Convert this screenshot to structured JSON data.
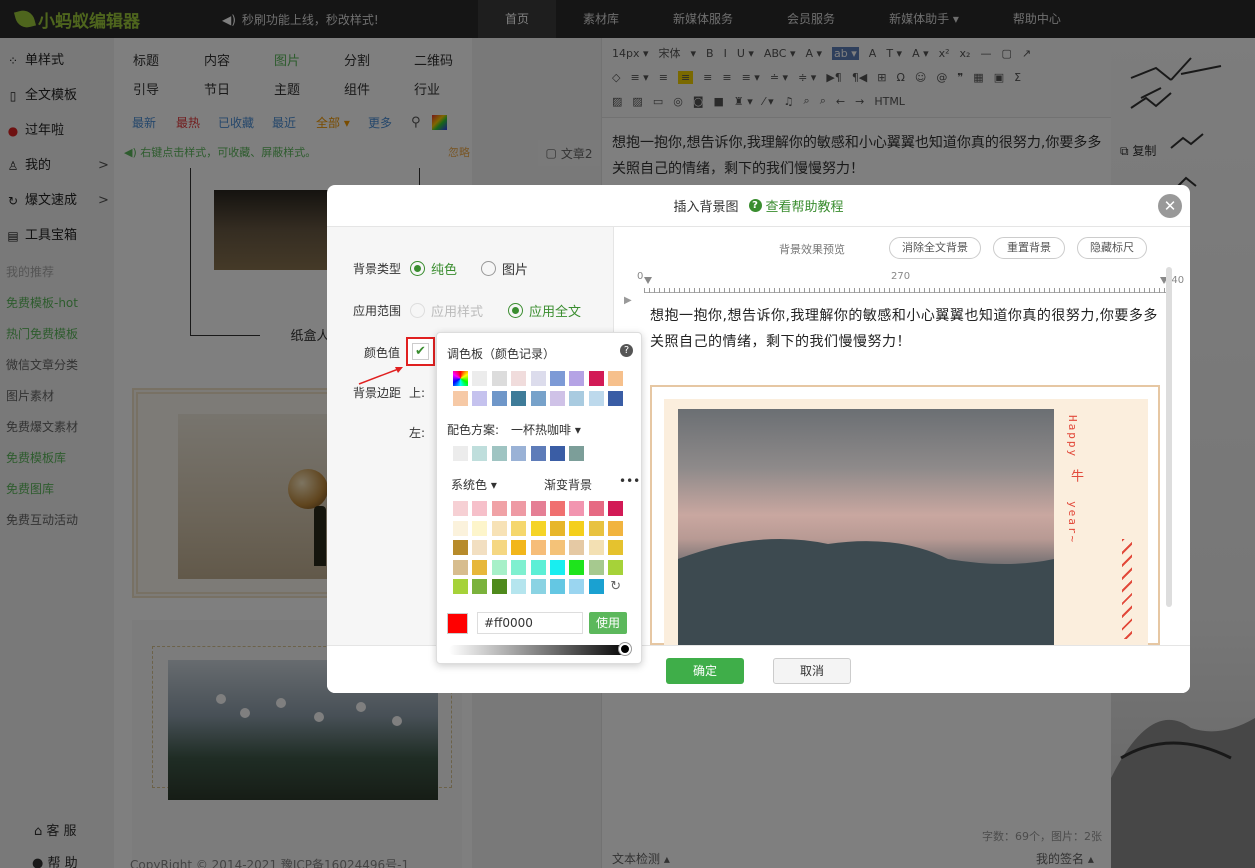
{
  "brand": {
    "logo": "小蚂蚁编辑器"
  },
  "notice": "秒刷功能上线，秒改样式!",
  "nav": [
    "首页",
    "素材库",
    "新媒体服务",
    "会员服务",
    "新媒体助手 ▾",
    "帮助中心"
  ],
  "sidebar": {
    "items": [
      {
        "icon": "grid-icon",
        "glyph": "⁘",
        "label": "单样式"
      },
      {
        "icon": "template-icon",
        "glyph": "▯",
        "label": "全文模板"
      },
      {
        "icon": "lantern-icon",
        "glyph": "●",
        "label": "过年啦"
      },
      {
        "icon": "user-icon",
        "glyph": "♙",
        "label": "我的",
        "arrow": ">"
      },
      {
        "icon": "bolt-icon",
        "glyph": "↻",
        "label": "爆文速成",
        "arrow": ">"
      },
      {
        "icon": "toolbox-icon",
        "glyph": "▤",
        "label": "工具宝箱"
      }
    ],
    "links": [
      {
        "label": "我的推荐",
        "green": false
      },
      {
        "label": "免费模板-hot",
        "green": true
      },
      {
        "label": "热门免费模板",
        "green": true
      },
      {
        "label": "微信文章分类",
        "green": false
      },
      {
        "label": "图片素材",
        "green": false
      },
      {
        "label": "免费爆文素材",
        "green": false
      },
      {
        "label": "免费模板库",
        "green": true
      },
      {
        "label": "免费图库",
        "green": true
      },
      {
        "label": "免费互动活动",
        "green": false
      }
    ],
    "service": "客 服",
    "help": "帮 助"
  },
  "styles": {
    "row1": [
      "标题",
      "内容",
      "图片",
      "分割",
      "二维码"
    ],
    "row2": [
      "引导",
      "节日",
      "主题",
      "组件",
      "行业"
    ],
    "filters": [
      "最新",
      "最热",
      "已收藏",
      "最近",
      "全部 ▾",
      "更多"
    ],
    "tip": "右键点击样式，可收藏、屏蔽样式。",
    "ignore": "忽略",
    "card_caption": "纸盒人"
  },
  "copyright": "CopyRight © 2014-2021 豫ICP备16024496号-1",
  "editor": {
    "article_tab": "文章2",
    "toolbar_row1": [
      "14px ▾",
      "宋体",
      "▾",
      "B",
      "I",
      "U ▾",
      "ABC ▾",
      "A ▾",
      "ab ▾",
      "A",
      "T ▾",
      "A ▾",
      "x²",
      "x₂",
      "—",
      "▢",
      "↗"
    ],
    "toolbar_row2": [
      "◇",
      "≡ ▾",
      "≡",
      "≡",
      "≡",
      "≡",
      "≡ ▾",
      "≐ ▾",
      "≑ ▾",
      "▶¶",
      "¶◀",
      "⊞",
      "Ω",
      "☺",
      "@",
      "❞",
      "▦",
      "▣",
      "Σ"
    ],
    "toolbar_row3": [
      "▨",
      "▨",
      "▭",
      "◎",
      "◙",
      "■",
      "♜ ▾",
      "⁄ ▾",
      "♫",
      "⌕",
      "⌕",
      "←",
      "→",
      "HTML"
    ],
    "text": "想抱一抱你,想告诉你,我理解你的敏感和小心翼翼也知道你真的很努力,你要多多关照自己的情绪，剩下的我们慢慢努力！",
    "word_count": "字数：69个，图片：2张",
    "check": "文本检测 ▴",
    "signature": "我的签名 ▴",
    "copy": "复制"
  },
  "modal": {
    "title": "插入背景图",
    "help_link": "查看帮助教程",
    "close": "✕",
    "bg_type_label": "背景类型",
    "bg_type_options": [
      "纯色",
      "图片"
    ],
    "scope_label": "应用范围",
    "scope_options": [
      "应用样式",
      "应用全文"
    ],
    "color_label": "颜色值",
    "margin_label": "背景边距",
    "margin_top": "上:",
    "margin_left": "左:",
    "preview_label": "背景效果预览",
    "buttons": [
      "消除全文背景",
      "重置背景",
      "隐藏标尺"
    ],
    "ruler": [
      "0",
      "270",
      "540"
    ],
    "preview_text": "想抱一抱你,想告诉你,我理解你的敏感和小心翼翼也知道你真的很努力,你要多多关照自己的情绪，剩下的我们慢慢努力！",
    "vertical_text": [
      "Happy",
      "牛",
      "year~"
    ],
    "ok": "确定",
    "cancel": "取消"
  },
  "picker": {
    "palette_title": "调色板（颜色记录）",
    "scheme_label": "配色方案:",
    "scheme_value": "一杯热咖啡 ▾",
    "system_label": "系统色 ▾",
    "gradient_label": "渐变背景",
    "more": "•••",
    "hex": "#ff0000",
    "use": "使用",
    "current_color": "#ff0000",
    "history": [
      "rainbow",
      "#ececec",
      "#dcdcdc",
      "#f0dcdc",
      "#dcdcec",
      "#7d9ad6",
      "#b5a3e5",
      "#d21a56",
      "#f6c08c",
      "#f6c9a6",
      "#c5c2ee",
      "#6f97c9",
      "#3f7c99",
      "#77a2ca",
      "#cfc2e7",
      "#a9cbe0",
      "#bdd9ec",
      "#3a5da5"
    ],
    "scheme": [
      "#ececec",
      "#bfdedc",
      "#9fc4c2",
      "#9ab2d6",
      "#5e7cb9",
      "#3a5da5",
      "#7c9e99"
    ],
    "system": [
      "#f6d0d4",
      "#f6c0ca",
      "#f0a2a6",
      "#ee9aa4",
      "#e57f95",
      "#f07070",
      "#f295b0",
      "#e66a83",
      "#d21a56",
      "#fbf2dc",
      "#fdf5cb",
      "#f7e2b6",
      "#f5d76d",
      "#f5d427",
      "#e7b62b",
      "#f4cf1c",
      "#e8c241",
      "#f1b440",
      "#b78b2b",
      "#f2dfc1",
      "#f5d782",
      "#f2b61b",
      "#f6bd79",
      "#f4c278",
      "#e5c9a4",
      "#f3e0b3",
      "#e5c22e",
      "#d7bd8e",
      "#e7b73a",
      "#a7f0c8",
      "#7ff0d0",
      "#5cefd6",
      "#18eef0",
      "#1ee41c",
      "#a6c98f",
      "#a6d239",
      "#a6d239",
      "#7bb23c",
      "#4f8a1c",
      "#b5e5ee",
      "#8ad3e3",
      "#64c7e3",
      "#9ad5f0",
      "#1aa1d1",
      "refresh"
    ]
  }
}
